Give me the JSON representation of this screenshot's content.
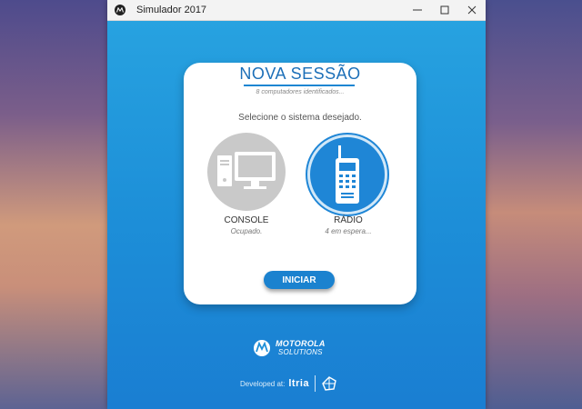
{
  "window": {
    "title": "Simulador 2017"
  },
  "card": {
    "title": "NOVA SESSÃO",
    "subtitle": "8 computadores identificados...",
    "prompt": "Selecione o sistema desejado.",
    "options": [
      {
        "label": "CONSOLE",
        "status": "Ocupado.",
        "icon": "computer-icon"
      },
      {
        "label": "RÁDIO",
        "status": "4 em espera...",
        "icon": "radio-icon"
      }
    ],
    "start_label": "INICIAR"
  },
  "brand": {
    "name": "MOTOROLA",
    "sub": "SOLUTIONS"
  },
  "developer": {
    "label": "Developed at:",
    "logo": "ltria"
  },
  "colors": {
    "accent": "#1d86d2",
    "client_bg": "#2196dc",
    "disabled": "#c9c9c9"
  }
}
